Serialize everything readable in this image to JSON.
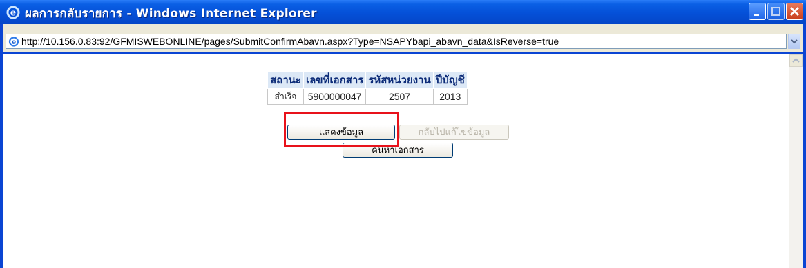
{
  "window": {
    "title": "ผลการกลับรายการ - Windows Internet Explorer",
    "url": "http://10.156.0.83:92/GFMISWEBONLINE/pages/SubmitConfirmAbavn.aspx?Type=NSAPYbapi_abavn_data&IsReverse=true",
    "icon": "ie-icon",
    "controls": [
      "minimize-icon",
      "maximize-icon",
      "close-icon"
    ]
  },
  "result_table": {
    "headers": [
      "สถานะ",
      "เลขที่เอกสาร",
      "รหัสหน่วยงาน",
      "ปีบัญชี"
    ],
    "rows": [
      [
        "สำเร็จ",
        "5900000047",
        "2507",
        "2013"
      ]
    ]
  },
  "buttons": {
    "show_data": "แสดงข้อมูล",
    "back_edit": "กลับไปแก้ไขข้อมูล",
    "search_document": "ค้นหาเอกสาร"
  },
  "colors": {
    "titlebar": "#0550d8",
    "table_header_bg": "#dce8f6",
    "highlight": "#e8121b"
  }
}
